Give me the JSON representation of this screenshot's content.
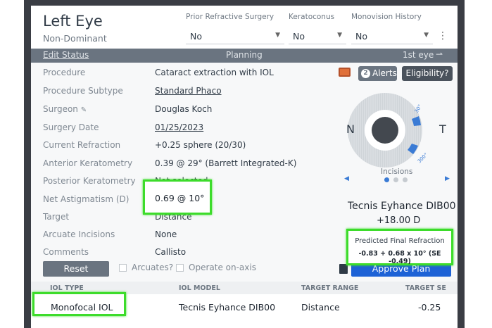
{
  "header": {
    "eye": "Left Eye",
    "dominance": "Non-Dominant",
    "fields": [
      {
        "label": "Prior Refractive Surgery",
        "value": "No"
      },
      {
        "label": "Keratoconus",
        "value": "No"
      },
      {
        "label": "Monovision History",
        "value": "No"
      }
    ]
  },
  "statusbar": {
    "edit": "Edit Status",
    "stage": "Planning",
    "eye_order": "1st eye"
  },
  "rows": [
    {
      "label": "Procedure",
      "value": "Cataract extraction with IOL"
    },
    {
      "label": "Procedure Subtype",
      "value": "Standard Phaco"
    },
    {
      "label": "Surgeon",
      "value": "Douglas Koch"
    },
    {
      "label": "Surgery Date",
      "value": "01/25/2023"
    },
    {
      "label": "Current Refraction",
      "value": "+0.25 sphere (20/30)"
    },
    {
      "label": "Anterior Keratometry",
      "value": "0.39 @ 29° (Barrett Integrated-K)"
    },
    {
      "label": "Posterior Keratometry",
      "value": "Not selected"
    },
    {
      "label": "Net Astigmatism (D)",
      "value": "0.69 @ 10°"
    },
    {
      "label": "Target",
      "value": "Distance"
    },
    {
      "label": "Arcuate Incisions",
      "value": "None"
    },
    {
      "label": "Comments",
      "value": "Callisto"
    }
  ],
  "actions": {
    "reset": "Reset",
    "arcuates": "Arcuates?",
    "on_axis": "Operate on-axis",
    "approve": "Approve Plan",
    "alerts_count": "2",
    "alerts": "Alerts",
    "eligibility": "Eligibility?"
  },
  "dial": {
    "nasal": "N",
    "temporal": "T",
    "mark_top": "30°",
    "mark_bottom": "300°",
    "incisions_label": "Incisions",
    "accent": "#3a7bd5"
  },
  "lens": {
    "name": "Tecnis Eyhance DIB00",
    "power": "+18.00 D"
  },
  "predicted": {
    "title": "Predicted Final Refraction",
    "value": "-0.83 + 0.68 x 10° (SE -0.49)"
  },
  "table": {
    "headers": [
      "IOL TYPE",
      "IOL MODEL",
      "TARGET RANGE",
      "TARGET SE"
    ],
    "row": [
      "Monofocal IOL",
      "Tecnis Eyhance DIB00",
      "Distance",
      "-0.25"
    ]
  },
  "highlight_color": "#3ddc2b"
}
